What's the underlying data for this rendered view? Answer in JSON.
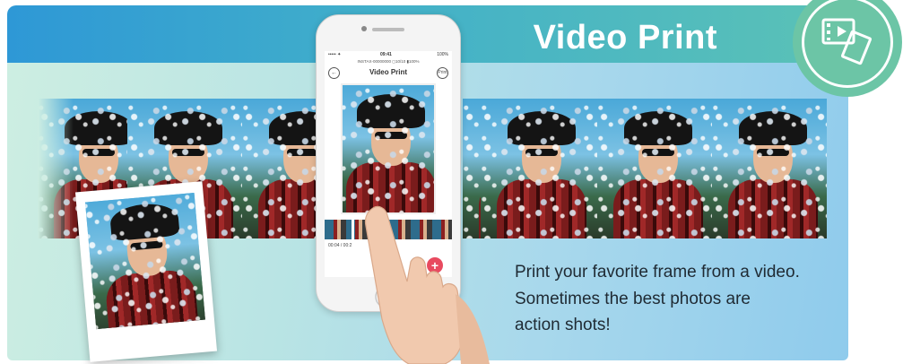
{
  "header": {
    "title": "Video Print"
  },
  "phone": {
    "status_time": "09:41",
    "status_carrier": "••••• ✦",
    "status_battery": "100%",
    "device_line": "INSTAX-00000000 ◻10/10 ▮100%",
    "screen_title": "Video Print",
    "back_label": "←",
    "print_label": "Print",
    "timecode": "00:04 / 00:2",
    "plus_label": "+"
  },
  "caption": {
    "line1": "Print your favorite frame from a video.",
    "line2": "Sometimes the best photos are",
    "line3": "action shots!"
  },
  "colors": {
    "banner_start": "#2e98d6",
    "banner_end": "#5bc2b6",
    "badge": "#6cc5a6",
    "accent_plus": "#e84a5f"
  },
  "icons": [
    "video-print-icon",
    "back-icon",
    "print-icon",
    "plus-icon",
    "hand-pointer-icon"
  ]
}
